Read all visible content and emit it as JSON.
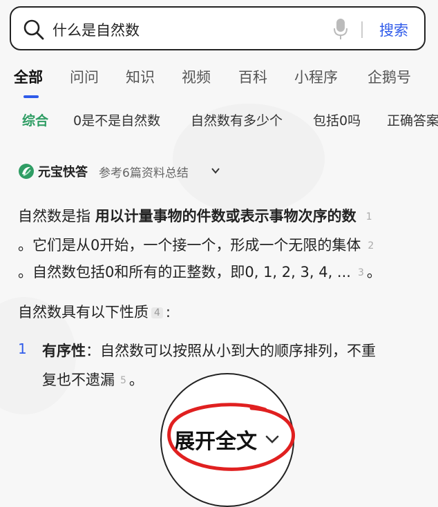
{
  "search": {
    "query": "什么是自然数",
    "button_label": "搜索"
  },
  "tabs": [
    "全部",
    "问问",
    "知识",
    "视频",
    "百科",
    "小程序",
    "企鹅号"
  ],
  "chips": [
    "综合",
    "0是不是自然数",
    "自然数有多少个",
    "包括0吗",
    "正确答案"
  ],
  "answer": {
    "source_name": "元宝快答",
    "references": "参考6篇资料总结",
    "p1_l1_prefix": "自然数是指 ",
    "p1_l1_bold": "用以计量事物的件数或表示事物次序的数",
    "p1_l2": "。它们是从0开始，一个接一个，形成一个无限的集体",
    "p1_l3": "。自然数包括0和所有的正整数，即0, 1, 2, 3, 4, ...",
    "p2": "自然数具有以下性质",
    "item1_number": "1",
    "item1_title": "有序性",
    "item1_l1": "：自然数可以按照从小到大的顺序排列，不重",
    "item1_l2": "复也不遗漏",
    "citations": [
      "1",
      "2",
      "3",
      "4",
      "5"
    ]
  },
  "expand_label": "展开全文",
  "colors": {
    "accent_blue": "#2f5bea",
    "chip_green": "#2f9d64",
    "annotation_red": "#e02020"
  }
}
